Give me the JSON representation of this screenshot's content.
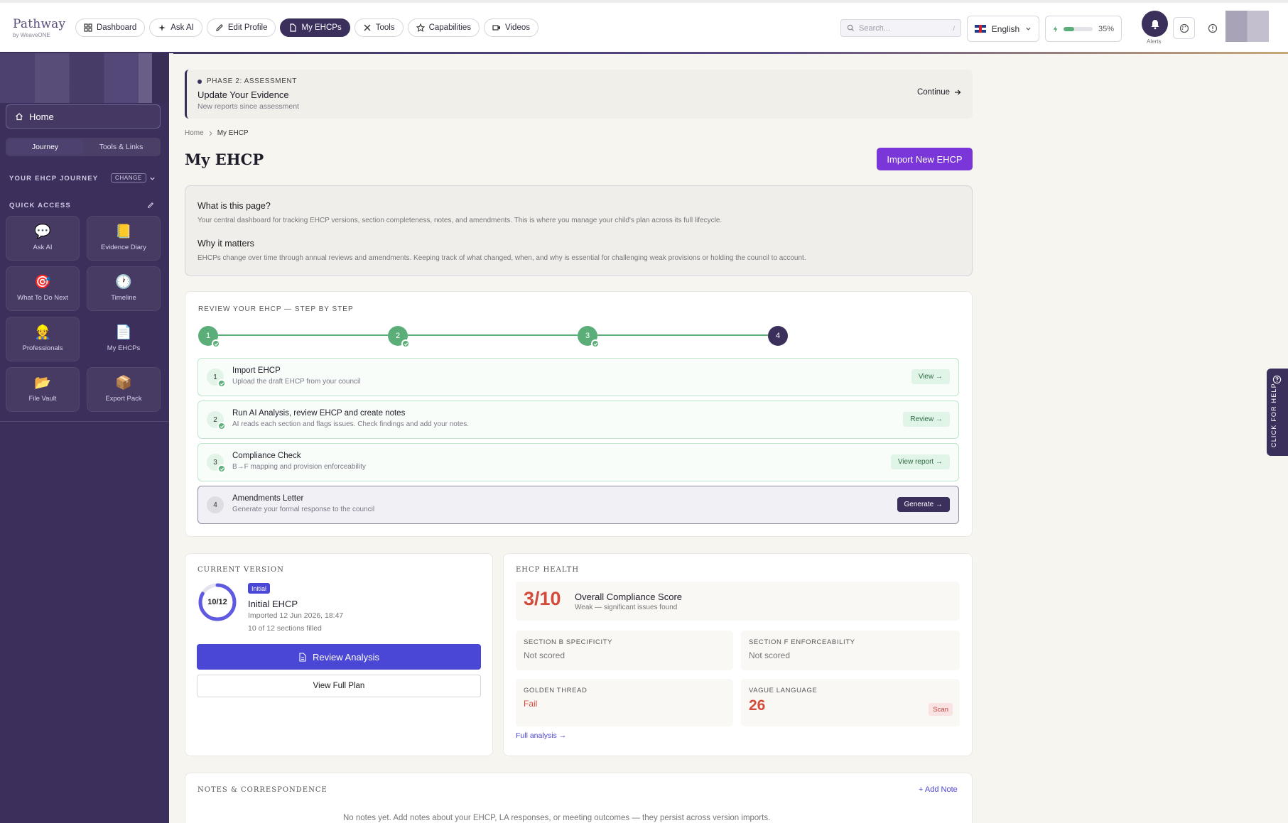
{
  "brand": {
    "name": "Pathway",
    "sub": "by WeaveONE"
  },
  "nav": [
    {
      "label": "Dashboard",
      "icon": "grid-icon"
    },
    {
      "label": "Ask AI",
      "icon": "sparkle-icon"
    },
    {
      "label": "Edit Profile",
      "icon": "pencil-icon"
    },
    {
      "label": "My EHCPs",
      "icon": "document-icon",
      "active": true
    },
    {
      "label": "Tools",
      "icon": "tools-icon"
    },
    {
      "label": "Capabilities",
      "icon": "star-icon"
    },
    {
      "label": "Videos",
      "icon": "video-icon"
    }
  ],
  "search": {
    "placeholder": "Search...",
    "shortcut": "/"
  },
  "language": {
    "label": "English"
  },
  "usage": {
    "percent_label": "35%",
    "fraction": 0.35
  },
  "alerts_label": "Alerts",
  "sidebar": {
    "home": "Home",
    "tabs": [
      "Journey",
      "Tools & Links"
    ],
    "journey_label": "YOUR EHCP JOURNEY",
    "change_label": "CHANGE",
    "quick_access_label": "QUICK ACCESS",
    "quick_access": [
      {
        "label": "Ask AI",
        "icon": "speech-bubble-icon",
        "glyph": "💬"
      },
      {
        "label": "Evidence Diary",
        "icon": "notebook-icon",
        "glyph": "📒"
      },
      {
        "label": "What To Do Next",
        "icon": "target-icon",
        "glyph": "🎯"
      },
      {
        "label": "Timeline",
        "icon": "clock-icon",
        "glyph": "🕐"
      },
      {
        "label": "Professionals",
        "icon": "professional-icon",
        "glyph": "👷"
      },
      {
        "label": "My EHCPs",
        "icon": "page-icon",
        "glyph": "📄"
      },
      {
        "label": "File Vault",
        "icon": "folder-icon",
        "glyph": "📂"
      },
      {
        "label": "Export Pack",
        "icon": "package-icon",
        "glyph": "📦"
      }
    ]
  },
  "phase": {
    "tag": "PHASE 2: ASSESSMENT",
    "title": "Update Your Evidence",
    "subtitle": "New reports since assessment",
    "cta": "Continue"
  },
  "breadcrumb": {
    "home": "Home",
    "current": "My EHCP"
  },
  "page_title": "My EHCP",
  "import_button": "Import New EHCP",
  "info": {
    "q1": "What is this page?",
    "a1": "Your central dashboard for tracking EHCP versions, section completeness, notes, and amendments. This is where you manage your child's plan across its full lifecycle.",
    "q2": "Why it matters",
    "a2": "EHCPs change over time through annual reviews and amendments. Keeping track of what changed, when, and why is essential for challenging weak provisions or holding the council to account."
  },
  "review": {
    "title": "REVIEW YOUR EHCP — STEP BY STEP",
    "steps": [
      {
        "num": "1",
        "title": "Import EHCP",
        "sub": "Upload the draft EHCP from your council",
        "button": "View →",
        "done": true
      },
      {
        "num": "2",
        "title": "Run AI Analysis, review EHCP and create notes",
        "sub": "AI reads each section and flags issues. Check findings and add your notes.",
        "button": "Review →",
        "done": true
      },
      {
        "num": "3",
        "title": "Compliance Check",
        "sub": "B→F mapping and provision enforceability",
        "button": "View report →",
        "done": true
      },
      {
        "num": "4",
        "title": "Amendments Letter",
        "sub": "Generate your formal response to the council",
        "button": "Generate →",
        "done": false
      }
    ]
  },
  "current_version": {
    "title": "CURRENT VERSION",
    "ring_label": "10/12",
    "ring_fraction": 0.8333,
    "badge": "Initial",
    "name": "Initial EHCP",
    "imported": "Imported 12 Jun 2026, 18:47",
    "sections": "10 of 12 sections filled",
    "review_button": "Review Analysis",
    "view_button": "View Full Plan"
  },
  "health": {
    "title": "EHCP HEALTH",
    "score": "3/10",
    "score_label": "Overall Compliance Score",
    "score_sub": "Weak — significant issues found",
    "metrics": [
      {
        "label": "SECTION B SPECIFICITY",
        "value": "Not scored"
      },
      {
        "label": "SECTION F ENFORCEABILITY",
        "value": "Not scored"
      },
      {
        "label": "GOLDEN THREAD",
        "value": "Fail"
      },
      {
        "label": "VAGUE LANGUAGE",
        "value": "26",
        "tag": "Scan"
      }
    ],
    "link": "Full analysis →"
  },
  "notes": {
    "title": "NOTES & CORRESPONDENCE",
    "add": "+ Add Note",
    "empty": "No notes yet. Add notes about your EHCP, LA responses, or meeting outcomes — they persist across version imports."
  },
  "help_tab": "CLICK FOR HELP",
  "colors": {
    "brand_dark": "#3b2f5c",
    "accent_purple": "#7a36d8",
    "primary_blue": "#4a46d6",
    "success_green": "#5cae78",
    "danger_red": "#d34b3b"
  }
}
